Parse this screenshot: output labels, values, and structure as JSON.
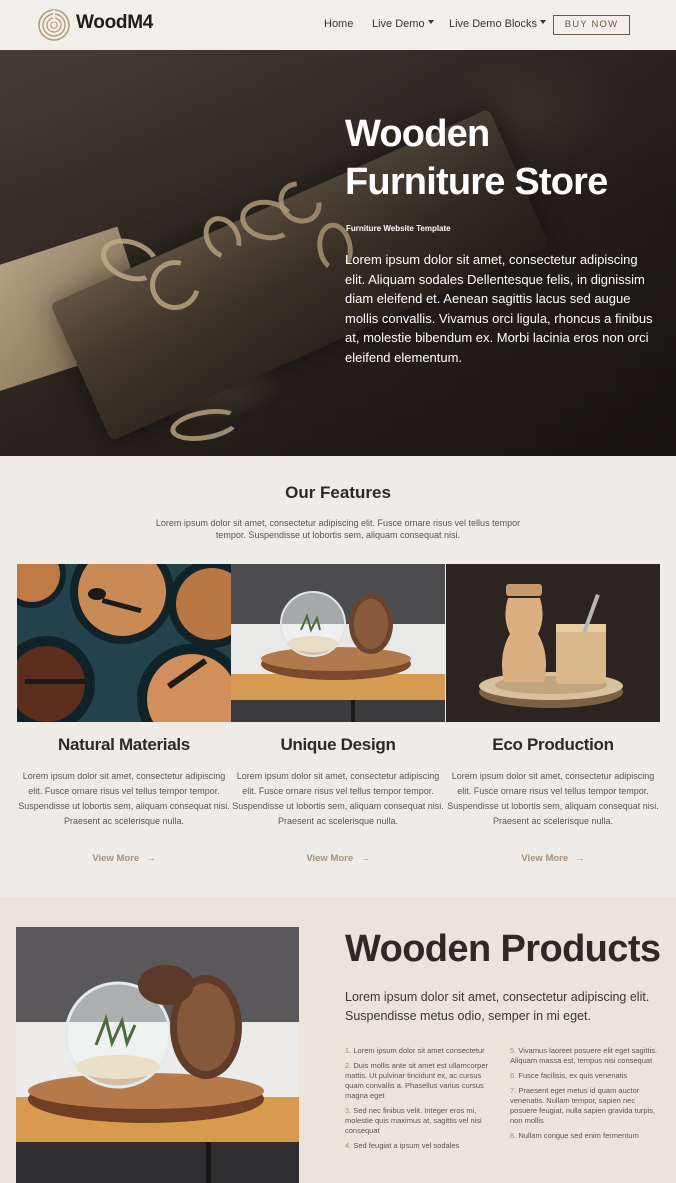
{
  "nav": {
    "brand": "WoodM4",
    "links": [
      {
        "label": "Home"
      },
      {
        "label": "Live Demo"
      },
      {
        "label": "Live Demo Blocks"
      }
    ],
    "cta": "BUY NOW"
  },
  "hero": {
    "title_line1": "Wooden",
    "title_line2": "Furniture Store",
    "subtitle": "Furniture Website Template",
    "text": "Lorem ipsum dolor sit amet, consectetur adipiscing elit. Aliquam sodales Dellentesque felis, in dignissim diam eleifend et. Aenean sagittis lacus sed augue mollis convallis. Vivamus orci ligula, rhoncus a finibus at, molestie bibendum ex. Morbi lacinia eros non orci eleifend elementum."
  },
  "features": {
    "title": "Our Features",
    "desc": "Lorem ipsum dolor sit amet, consectetur adipiscing elit. Fusce ornare risus vel tellus tempor tempor. Suspendisse ut lobortis sem, aliquam consequat nisi.",
    "items": [
      {
        "title": "Natural Materials",
        "text": "Lorem ipsum dolor sit amet, consectetur adipiscing elit. Fusce ornare risus vel tellus tempor tempor. Suspendisse ut lobortis sem, aliquam consequat nisi. Praesent ac scelerisque nulla.",
        "link": "View More"
      },
      {
        "title": "Unique Design",
        "text": "Lorem ipsum dolor sit amet, consectetur adipiscing elit. Fusce ornare risus vel tellus tempor tempor. Suspendisse ut lobortis sem, aliquam consequat nisi. Praesent ac scelerisque nulla.",
        "link": "View More"
      },
      {
        "title": "Eco Production",
        "text": "Lorem ipsum dolor sit amet, consectetur adipiscing elit. Fusce ornare risus vel tellus tempor tempor. Suspendisse ut lobortis sem, aliquam consequat nisi. Praesent ac scelerisque nulla.",
        "link": "View More"
      }
    ]
  },
  "products": {
    "title": "Wooden Products",
    "lead": "Lorem ipsum dolor sit amet, consectetur adipiscing elit. Suspendisse metus odio, semper in mi eget.",
    "list_left": [
      {
        "num": "1.",
        "text": "Lorem ipsum dolor sit amet consectetur"
      },
      {
        "num": "2.",
        "text": "Duis mollis ante sit amet est ullamcorper mattis. Ut pulvinar tincidunt ex, ac cursus quam convallis a. Phasellus varius cursus magna eget"
      },
      {
        "num": "3.",
        "text": "Sed nec finibus velit. Integer eros mi, molestie quis maximus at, sagittis vel nisi consequat"
      },
      {
        "num": "4.",
        "text": "Sed feugiat a ipsum vel sodales"
      }
    ],
    "list_right": [
      {
        "num": "5.",
        "text": "Vivamus laoreet posuere elit eget sagittis. Aliquam massa est, tempus nisi consequat"
      },
      {
        "num": "6.",
        "text": "Fusce facilisis, ex quis venenatis"
      },
      {
        "num": "7.",
        "text": "Praesent eget metus id quam auctor venenatis. Nullam tempor, sapien nec posuere feugiat, nulla sapien gravida turpis, non mollis"
      },
      {
        "num": "8.",
        "text": "Nullam congue sed enim fermentum"
      }
    ]
  }
}
